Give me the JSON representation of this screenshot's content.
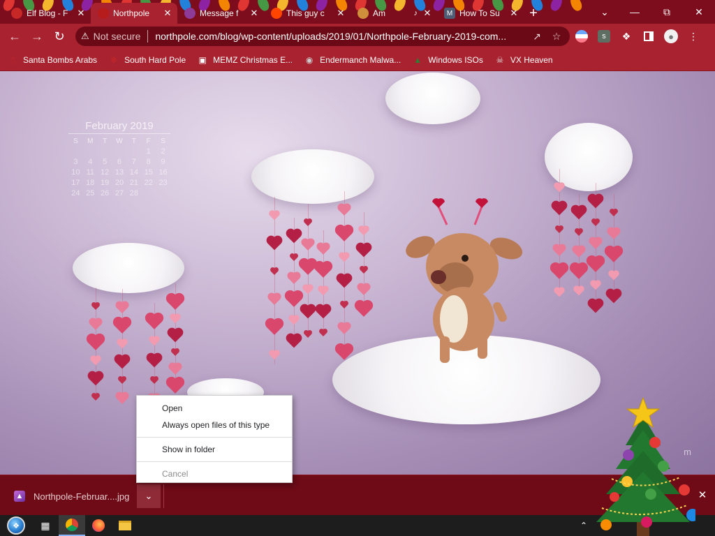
{
  "tabs": [
    {
      "title": "Elf Blog - F",
      "favicon": "santa-favicon",
      "fav_color": "#c62828",
      "active": false
    },
    {
      "title": "Northpole",
      "favicon": "northpole-favicon",
      "fav_color": "#b71c1c",
      "active": true
    },
    {
      "title": "Message f",
      "favicon": "message-favicon",
      "fav_color": "#8e3b98",
      "active": false
    },
    {
      "title": "This guy c",
      "favicon": "reddit-favicon",
      "fav_color": "#ff4500",
      "active": false
    },
    {
      "title": "Am",
      "favicon": "audio-playing-favicon",
      "fav_color": "#cf8f3c",
      "active": false
    },
    {
      "title": "How To Su",
      "favicon": "m-favicon",
      "fav_color": "#4e5d73",
      "active": false
    }
  ],
  "tab_favicon_glyphs": {
    "m": "M"
  },
  "toolbar": {
    "not_secure": "Not secure",
    "url": "northpole.com/blog/wp-content/uploads/2019/01/Northpole-February-2019-com..."
  },
  "bookmarks": [
    {
      "label": "Santa Bombs Arabs",
      "icon": "santa-icon",
      "color": "#c62828"
    },
    {
      "label": "South Hard Pole",
      "icon": "snowflake-icon",
      "color": "#c62828"
    },
    {
      "label": "MEMZ Christmas E...",
      "icon": "memz-icon",
      "color": "#ffffff"
    },
    {
      "label": "Endermanch Malwa...",
      "icon": "raccoon-icon",
      "color": "#cccccc"
    },
    {
      "label": "Windows ISOs",
      "icon": "tree-icon",
      "color": "#2e7d32"
    },
    {
      "label": "VX Heaven",
      "icon": "vx-icon",
      "color": "#dddddd"
    }
  ],
  "calendar": {
    "title": "February 2019",
    "weekdays": [
      "S",
      "M",
      "T",
      "W",
      "T",
      "F",
      "S"
    ],
    "weeks": [
      [
        "",
        "",
        "",
        "",
        "",
        "1",
        "2"
      ],
      [
        "3",
        "4",
        "5",
        "6",
        "7",
        "8",
        "9"
      ],
      [
        "10",
        "11",
        "12",
        "13",
        "14",
        "15",
        "16"
      ],
      [
        "17",
        "18",
        "19",
        "20",
        "21",
        "22",
        "23"
      ],
      [
        "24",
        "25",
        "26",
        "27",
        "28",
        "",
        ""
      ]
    ]
  },
  "watermark": "m",
  "context_menu": {
    "items": [
      {
        "label": "Open",
        "name": "menu-open",
        "disabled": false,
        "sep_after": false
      },
      {
        "label": "Always open files of this type",
        "name": "menu-always-open",
        "disabled": false,
        "sep_after": true
      },
      {
        "label": "Show in folder",
        "name": "menu-show-in-folder",
        "disabled": false,
        "sep_after": true
      },
      {
        "label": "Cancel",
        "name": "menu-cancel",
        "disabled": true,
        "sep_after": false
      }
    ]
  },
  "download": {
    "filename": "Northpole-Februar....jpg"
  },
  "colors": {
    "tabstrip": "#7d0d1c",
    "toolbar": "#a8222f",
    "shelf": "#6e0b17",
    "content_bg": "#b8a3c6",
    "heart_red": "#c0304e",
    "heart_pink": "#e87a98"
  }
}
